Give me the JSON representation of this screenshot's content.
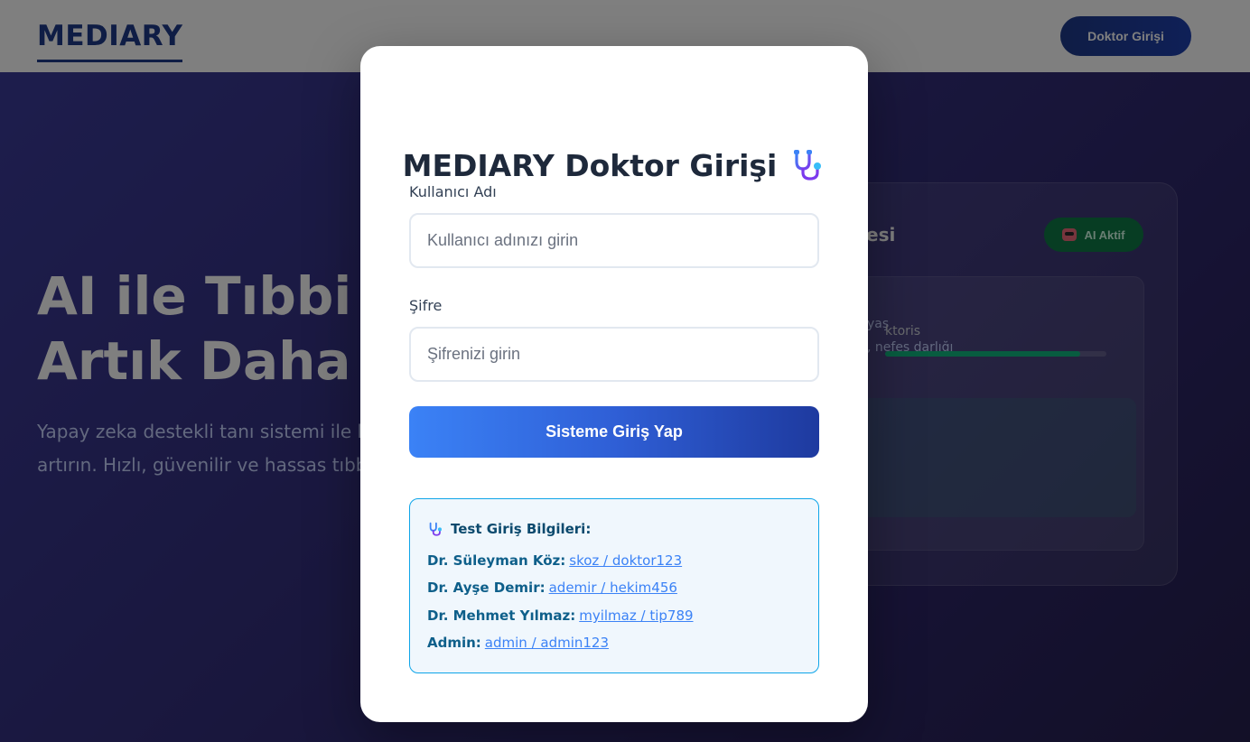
{
  "navbar": {
    "logo": "MEDIARY",
    "login_button": "Doktor Girişi"
  },
  "hero": {
    "title_line1": "AI ile Tıbbi T",
    "title_line2": "Artık Daha K",
    "subtitle_line1": "Yapay zeka destekli tanı sistemi ile he",
    "subtitle_line2": "artırın. Hızlı, güvenilir ve hassas tıbbi"
  },
  "demo_card": {
    "title": "esi",
    "badge": "AI Aktif",
    "patient_line1": "yaş",
    "patient_line2": ", nefes darlığı",
    "diagnosis": "ktoris",
    "confidence": 0.88
  },
  "modal": {
    "title": "MEDIARY Doktor Girişi",
    "username_label": "Kullanıcı Adı",
    "username_placeholder": "Kullanıcı adınızı girin",
    "password_label": "Şifre",
    "password_placeholder": "Şifrenizi girin",
    "submit": "Sisteme Giriş Yap",
    "test_title": "Test Giriş Bilgileri:",
    "credentials": [
      {
        "name": "Dr. Süleyman Köz:",
        "account": "skoz / doktor123"
      },
      {
        "name": "Dr. Ayşe Demir:",
        "account": "ademir / hekim456"
      },
      {
        "name": "Dr. Mehmet Yılmaz:",
        "account": "myilmaz / tip789"
      },
      {
        "name": "Admin:",
        "account": "admin / admin123"
      }
    ]
  },
  "colors": {
    "brand": "#1e3a8a",
    "primary": "#3b82f6",
    "success": "#10b981"
  }
}
